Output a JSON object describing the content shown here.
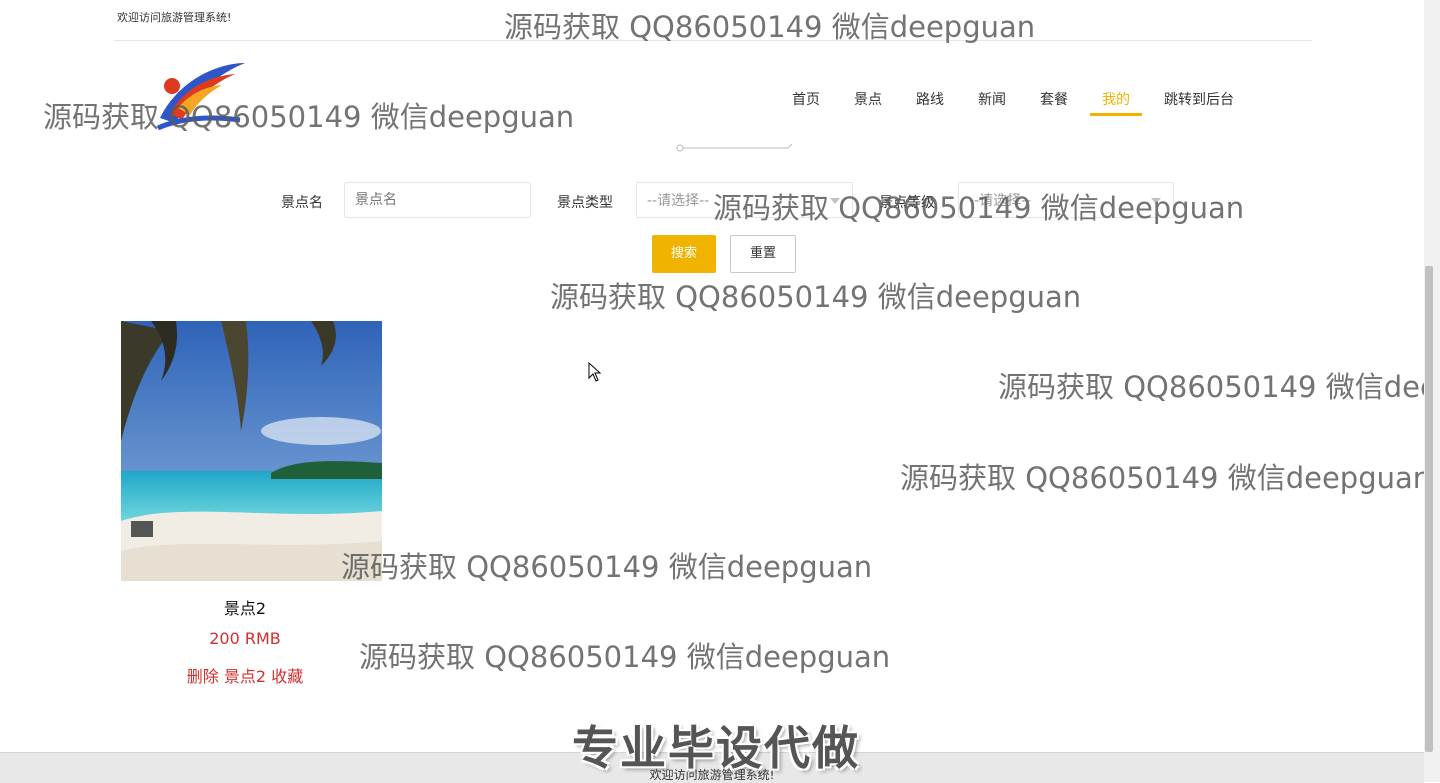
{
  "header": {
    "welcome": "欢迎访问旅游管理系统!"
  },
  "nav": {
    "items": [
      {
        "label": "首页"
      },
      {
        "label": "景点"
      },
      {
        "label": "路线"
      },
      {
        "label": "新闻"
      },
      {
        "label": "套餐"
      },
      {
        "label": "我的",
        "active": true
      },
      {
        "label": "跳转到后台"
      }
    ]
  },
  "search": {
    "name_label": "景点名",
    "name_placeholder": "景点名",
    "type_label": "景点类型",
    "type_value": "--请选择--",
    "level_label": "景点等级",
    "level_value": "--请选择--",
    "search_button": "搜索",
    "reset_button": "重置"
  },
  "card": {
    "title": "景点2",
    "price": "200 RMB",
    "delete": "删除",
    "name": "景点2",
    "favorite": "收藏"
  },
  "footer": {
    "text": "欢迎访问旅游管理系统!"
  },
  "watermark": {
    "text": "源码获取 QQ86050149 微信deepguan",
    "promo": "专业毕设代做"
  },
  "colors": {
    "accent": "#f0b400",
    "price": "#d32f2f"
  }
}
